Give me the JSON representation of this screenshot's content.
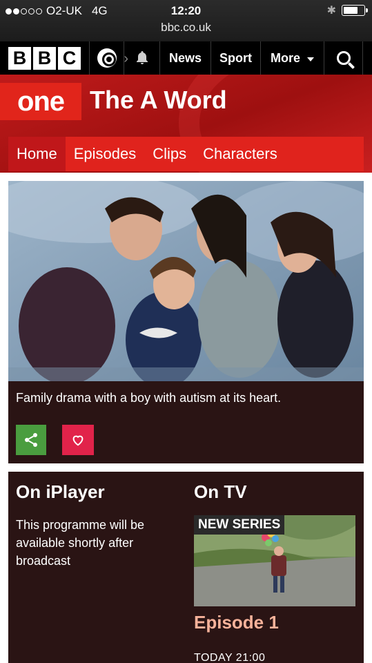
{
  "status_bar": {
    "carrier": "O2-UK",
    "network": "4G",
    "time": "12:20",
    "signal_bars": 2,
    "battery_level": 0.7,
    "url": "bbc.co.uk"
  },
  "bbc_nav": {
    "logo_letters": [
      "B",
      "B",
      "C"
    ],
    "items": [
      "News",
      "Sport",
      "More"
    ],
    "icons": [
      "account-icon",
      "notifications-bell-icon",
      "search-icon"
    ]
  },
  "brand": {
    "channel_logo": "one",
    "show_title": "The A Word",
    "tabs": [
      "Home",
      "Episodes",
      "Clips",
      "Characters"
    ],
    "active_tab": "Home",
    "accent_color": "#e0231d"
  },
  "hero": {
    "description": "Family drama with a boy with autism at its heart.",
    "share_color": "#4a9d3f",
    "favourite_color": "#e1234a"
  },
  "iplayer": {
    "heading": "On iPlayer",
    "text": "This programme will be available shortly after broadcast"
  },
  "on_tv": {
    "heading": "On TV",
    "badge": "NEW SERIES",
    "episode_title": "Episode 1",
    "broadcast_time": "TODAY 21:00",
    "title_color": "#f7b29a"
  }
}
